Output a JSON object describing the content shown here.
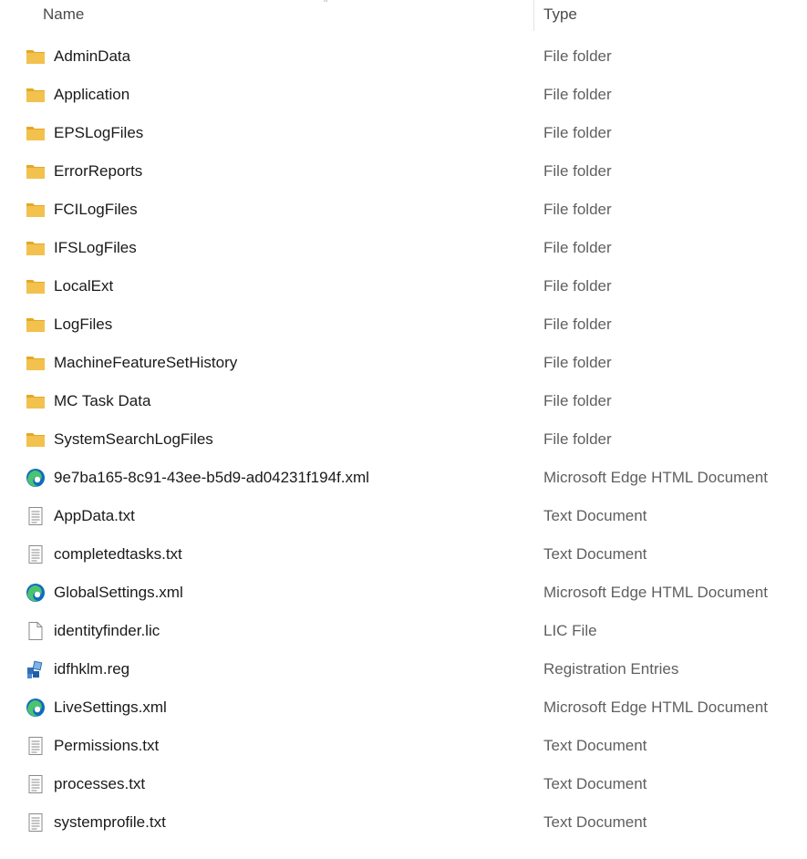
{
  "header": {
    "name_label": "Name",
    "type_label": "Type",
    "sort_indicator": "^"
  },
  "icon_colors": {
    "folder": "#f2c14e",
    "folder_tab": "#e5a823",
    "edge_blue": "#0f6cbd",
    "edge_green": "#4cc36f",
    "doc_outline": "#8a8a8a"
  },
  "files": [
    {
      "name": "AdminData",
      "type": "File folder",
      "icon": "folder-icon"
    },
    {
      "name": "Application",
      "type": "File folder",
      "icon": "folder-icon"
    },
    {
      "name": "EPSLogFiles",
      "type": "File folder",
      "icon": "folder-icon"
    },
    {
      "name": "ErrorReports",
      "type": "File folder",
      "icon": "folder-icon"
    },
    {
      "name": "FCILogFiles",
      "type": "File folder",
      "icon": "folder-icon"
    },
    {
      "name": "IFSLogFiles",
      "type": "File folder",
      "icon": "folder-icon"
    },
    {
      "name": "LocalExt",
      "type": "File folder",
      "icon": "folder-icon"
    },
    {
      "name": "LogFiles",
      "type": "File folder",
      "icon": "folder-icon"
    },
    {
      "name": "MachineFeatureSetHistory",
      "type": "File folder",
      "icon": "folder-icon"
    },
    {
      "name": "MC Task Data",
      "type": "File folder",
      "icon": "folder-icon"
    },
    {
      "name": "SystemSearchLogFiles",
      "type": "File folder",
      "icon": "folder-icon"
    },
    {
      "name": "9e7ba165-8c91-43ee-b5d9-ad04231f194f.xml",
      "type": "Microsoft Edge HTML Document",
      "icon": "edge-icon"
    },
    {
      "name": "AppData.txt",
      "type": "Text Document",
      "icon": "text-document-icon"
    },
    {
      "name": "completedtasks.txt",
      "type": "Text Document",
      "icon": "text-document-icon"
    },
    {
      "name": "GlobalSettings.xml",
      "type": "Microsoft Edge HTML Document",
      "icon": "edge-icon"
    },
    {
      "name": "identityfinder.lic",
      "type": "LIC File",
      "icon": "blank-file-icon"
    },
    {
      "name": "idfhklm.reg",
      "type": "Registration Entries",
      "icon": "registry-icon"
    },
    {
      "name": "LiveSettings.xml",
      "type": "Microsoft Edge HTML Document",
      "icon": "edge-icon"
    },
    {
      "name": "Permissions.txt",
      "type": "Text Document",
      "icon": "text-document-icon"
    },
    {
      "name": "processes.txt",
      "type": "Text Document",
      "icon": "text-document-icon"
    },
    {
      "name": "systemprofile.txt",
      "type": "Text Document",
      "icon": "text-document-icon"
    }
  ]
}
